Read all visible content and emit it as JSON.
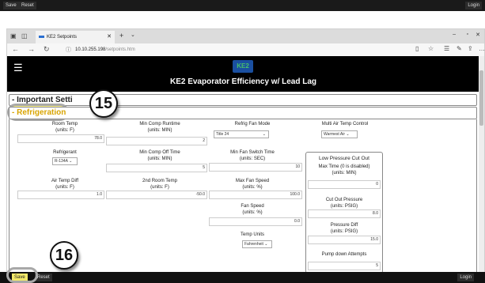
{
  "app_bar": {
    "save_label": "Save",
    "reset_label": "Reset",
    "login_label": "Login"
  },
  "browser": {
    "tab_title": "KE2 Setpoints",
    "url_host": "10.10.255.198",
    "url_path": "/setpoints.htm"
  },
  "header": {
    "logo_text": "KE2",
    "title": "KE2 Evaporator Efficiency w/ Lead Lag"
  },
  "sections": {
    "important": "- Important Setti",
    "refrigeration": "- Refrigeration"
  },
  "form": {
    "room_temp": {
      "label": "Room Temp",
      "units": "(units: F)",
      "value": "78.0"
    },
    "min_comp_runtime": {
      "label": "Min Comp Runtime",
      "units": "(units: MIN)",
      "value": "2"
    },
    "refrig_fan_mode": {
      "label": "Refrig Fan Mode",
      "selected": "Title 24"
    },
    "multi_air_temp": {
      "label": "Multi Air Temp Control",
      "selected": "Warmest Air"
    },
    "refrigerant": {
      "label": "Refrigerant",
      "selected": "R-134A"
    },
    "min_comp_off": {
      "label": "Min Comp Off Time",
      "units": "(units: MIN)",
      "value": "5"
    },
    "min_fan_switch": {
      "label": "Min Fan Switch Time",
      "units": "(units: SEC)",
      "value": "10"
    },
    "air_temp_diff": {
      "label": "Air Temp Diff",
      "units": "(units: F)",
      "value": "1.0"
    },
    "room_temp_2": {
      "label": "2nd Room Temp",
      "units": "(units: F)",
      "value": "-50.0"
    },
    "max_fan_speed": {
      "label": "Max Fan Speed",
      "units": "(units: %)",
      "value": "100.0"
    },
    "fan_speed": {
      "label": "Fan Speed",
      "units": "(units: %)",
      "value": "0.0"
    },
    "temp_units": {
      "label": "Temp Units",
      "selected": "Fahrenheit"
    }
  },
  "low_pressure": {
    "title": "Low Pressure Cut Out",
    "max_time": {
      "label": "Max Time (0 is disabled)",
      "units": "(units: MIN)",
      "value": "0"
    },
    "cut_out": {
      "label": "Cut Out Pressure",
      "units": "(units: PSIG)",
      "value": "8.0"
    },
    "diff": {
      "label": "Pressure Diff",
      "units": "(units: PSIG)",
      "value": "15.0"
    },
    "pump_down": {
      "label": "Pump down Attempts",
      "value": "5"
    }
  },
  "callouts": {
    "first": "15",
    "second": "16"
  },
  "colors": {
    "section_highlight": "#d8a400",
    "header_bg": "#000000",
    "callout_highlight": "#fff56e"
  },
  "icons": [
    "tab-actions-icon",
    "back-icon",
    "forward-icon",
    "refresh-icon",
    "info-icon",
    "favorite-icon",
    "menu-icon"
  ]
}
